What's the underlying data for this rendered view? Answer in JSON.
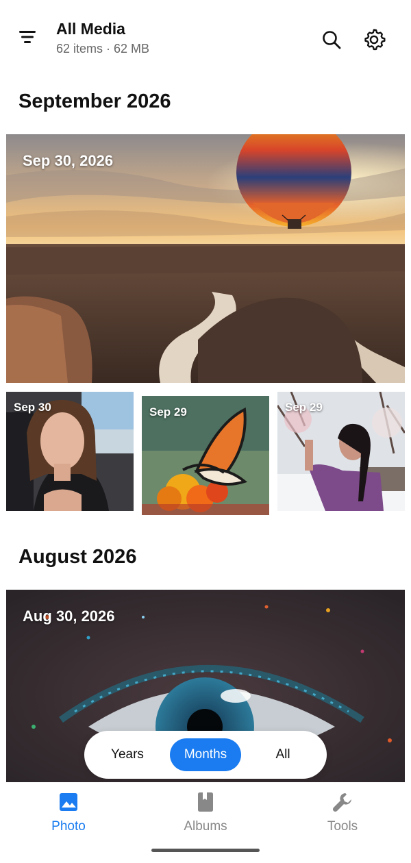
{
  "header": {
    "title": "All Media",
    "subtitle": "62 items · 62 MB"
  },
  "sections": [
    {
      "title": "September 2026",
      "hero_date": "Sep 30, 2026",
      "thumbs": [
        {
          "date": "Sep 30"
        },
        {
          "date": "Sep 29"
        },
        {
          "date": "Sep 29"
        }
      ]
    },
    {
      "title": "August 2026",
      "hero_date": "Aug 30, 2026"
    }
  ],
  "view_toggle": {
    "options": [
      "Years",
      "Months",
      "All"
    ],
    "selected": "Months"
  },
  "bottom_nav": {
    "items": [
      {
        "label": "Photo",
        "icon": "image-icon"
      },
      {
        "label": "Albums",
        "icon": "book-icon"
      },
      {
        "label": "Tools",
        "icon": "wrench-icon"
      }
    ],
    "active": "Photo"
  },
  "colors": {
    "accent": "#1a7cf0",
    "inactive": "#888888"
  }
}
